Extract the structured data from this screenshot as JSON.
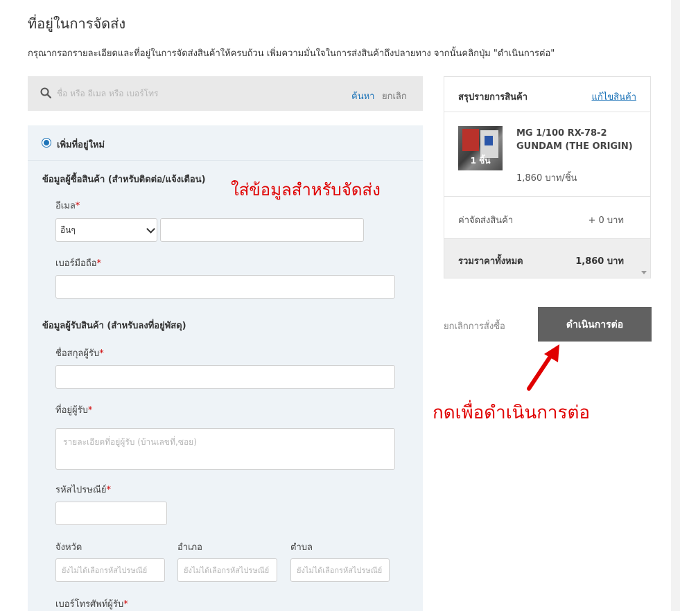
{
  "page": {
    "title": "ที่อยู่ในการจัดส่ง",
    "subtitle": "กรุณากรอกรายละเอียดและที่อยู่ในการจัดส่งสินค้าให้ครบถ้วน เพิ่มความมั่นใจในการส่งสินค้าถึงปลายทาง จากนั้นคลิกปุ่ม \"ดำเนินการต่อ\""
  },
  "search": {
    "placeholder": "ชื่อ หรือ อีเมล หรือ เบอร์โทร",
    "search_label": "ค้นหา",
    "cancel_label": "ยกเลิก"
  },
  "form": {
    "new_address_label": "เพิ่มที่อยู่ใหม่",
    "buyer_section": "ข้อมูลผู้ซื้อสินค้า (สำหรับติดต่อ/แจ้งเตือน)",
    "email_label": "อีเมล",
    "email_type_selected": "อื่นๆ",
    "email_value": "",
    "mobile_label": "เบอร์มือถือ",
    "recipient_section": "ข้อมูลผู้รับสินค้า (สำหรับลงที่อยู่พัสดุ)",
    "name_label": "ชื่อสกุลผู้รับ",
    "address_label": "ที่อยู่ผู้รับ",
    "address_placeholder": "รายละเอียดที่อยู่ผู้รับ (บ้านเลขที่,ซอย)",
    "postcode_label": "รหัสไปรษณีย์",
    "province_label": "จังหวัด",
    "province_placeholder": "ยังไม่ได้เลือกรหัสไปรษณีย์",
    "district_label": "อำเภอ",
    "district_placeholder": "ยังไม่ได้เลือกรหัสไปรษณีย์",
    "subdistrict_label": "ตำบล",
    "subdistrict_placeholder": "ยังไม่ได้เลือกรหัสไปรษณีย์",
    "phone_label": "เบอร์โทรศัพท์ผู้รับ",
    "required_mark": "*"
  },
  "annotations": {
    "fill_shipping": "ใส่ข้อมูลสำหรับจัดส่ง",
    "press_continue": "กดเพื่อดำเนินการต่อ",
    "color": "#e00000"
  },
  "summary": {
    "title": "สรุปรายการสินค้า",
    "edit_label": "แก้ไขสินค้า",
    "product": {
      "name": "MG 1/100 RX-78-2 GUNDAM (THE ORIGIN)",
      "quantity": "1 ชิ้น",
      "unit_price": "1,860 บาท/ชิ้น"
    },
    "shipping_label": "ค่าจัดส่งสินค้า",
    "shipping_value": "+ 0 บาท",
    "total_label": "รวมราคาทั้งหมด",
    "total_value": "1,860 บาท"
  },
  "actions": {
    "cancel_order": "ยกเลิกการสั่งซื้อ",
    "proceed": "ดำเนินการต่อ"
  },
  "colors": {
    "link": "#1e74b8",
    "button_bg": "#616161",
    "panel_bg": "#eef3f7"
  }
}
